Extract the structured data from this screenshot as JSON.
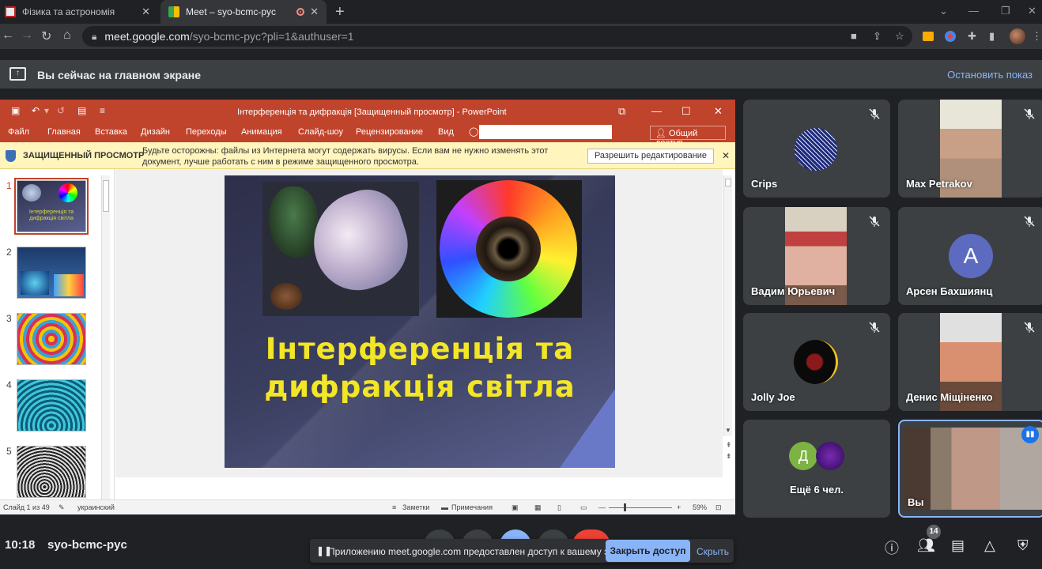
{
  "browser": {
    "tabs": [
      {
        "title": "Фізика та астрономія",
        "active": false
      },
      {
        "title": "Meet – syo-bcmc-pyc",
        "active": true
      }
    ],
    "url_host": "meet.google.com",
    "url_path": "/syo-bcmc-pyc?pli=1&authuser=1"
  },
  "share_banner": {
    "text": "Вы сейчас на главном экране",
    "stop": "Остановить показ"
  },
  "powerpoint": {
    "title": "Інтерференція та дифракція [Защищенный просмотр] - PowerPoint",
    "menu": [
      "Файл",
      "Главная",
      "Вставка",
      "Дизайн",
      "Переходы",
      "Анимация",
      "Слайд-шоу",
      "Рецензирование",
      "Вид"
    ],
    "share": "Общий доступ",
    "protected_label": "ЗАЩИЩЕННЫЙ ПРОСМОТР",
    "protected_msg": "Будьте осторожны: файлы из Интернета могут содержать вирусы. Если вам не нужно изменять этот документ, лучше работать с ним в режиме защищенного просмотра.",
    "enable_edit": "Разрешить редактирование",
    "thumbs": [
      {
        "n": "1",
        "caption": "Інтерференція та дифракція світла"
      },
      {
        "n": "2",
        "caption": ""
      },
      {
        "n": "3",
        "caption": ""
      },
      {
        "n": "4",
        "caption": ""
      },
      {
        "n": "5",
        "caption": ""
      }
    ],
    "slide_title_1": "Інтерференція та",
    "slide_title_2": "дифракція світла",
    "status": {
      "slide": "Слайд 1 из 49",
      "lang": "украинский",
      "notes": "Заметки",
      "comments": "Примечания",
      "zoom": "59%"
    }
  },
  "participants": [
    {
      "name": "Crips",
      "muted": true
    },
    {
      "name": "Max Petrakov",
      "muted": true
    },
    {
      "name": "Вадим Юрьевич",
      "muted": true
    },
    {
      "name": "Арсен Бахшиянц",
      "muted": true,
      "initial": "A"
    },
    {
      "name": "Jolly Joe",
      "muted": true
    },
    {
      "name": "Денис Міщіненко",
      "muted": true
    },
    {
      "name": "Ещё 6 чел.",
      "initial": "Д"
    },
    {
      "name": "Вы",
      "speaking": true
    }
  ],
  "bottom": {
    "time": "10:18",
    "code": "syo-bcmc-pyc",
    "notice": "Приложению meet.google.com предоставлен доступ к вашему экрану.",
    "close_access": "Закрыть доступ",
    "hide": "Скрыть",
    "people_count": "14"
  },
  "colors": {
    "ppt_red": "#c0432b",
    "meet_blue": "#8ab4f8",
    "slide_title": "#f2e626"
  }
}
